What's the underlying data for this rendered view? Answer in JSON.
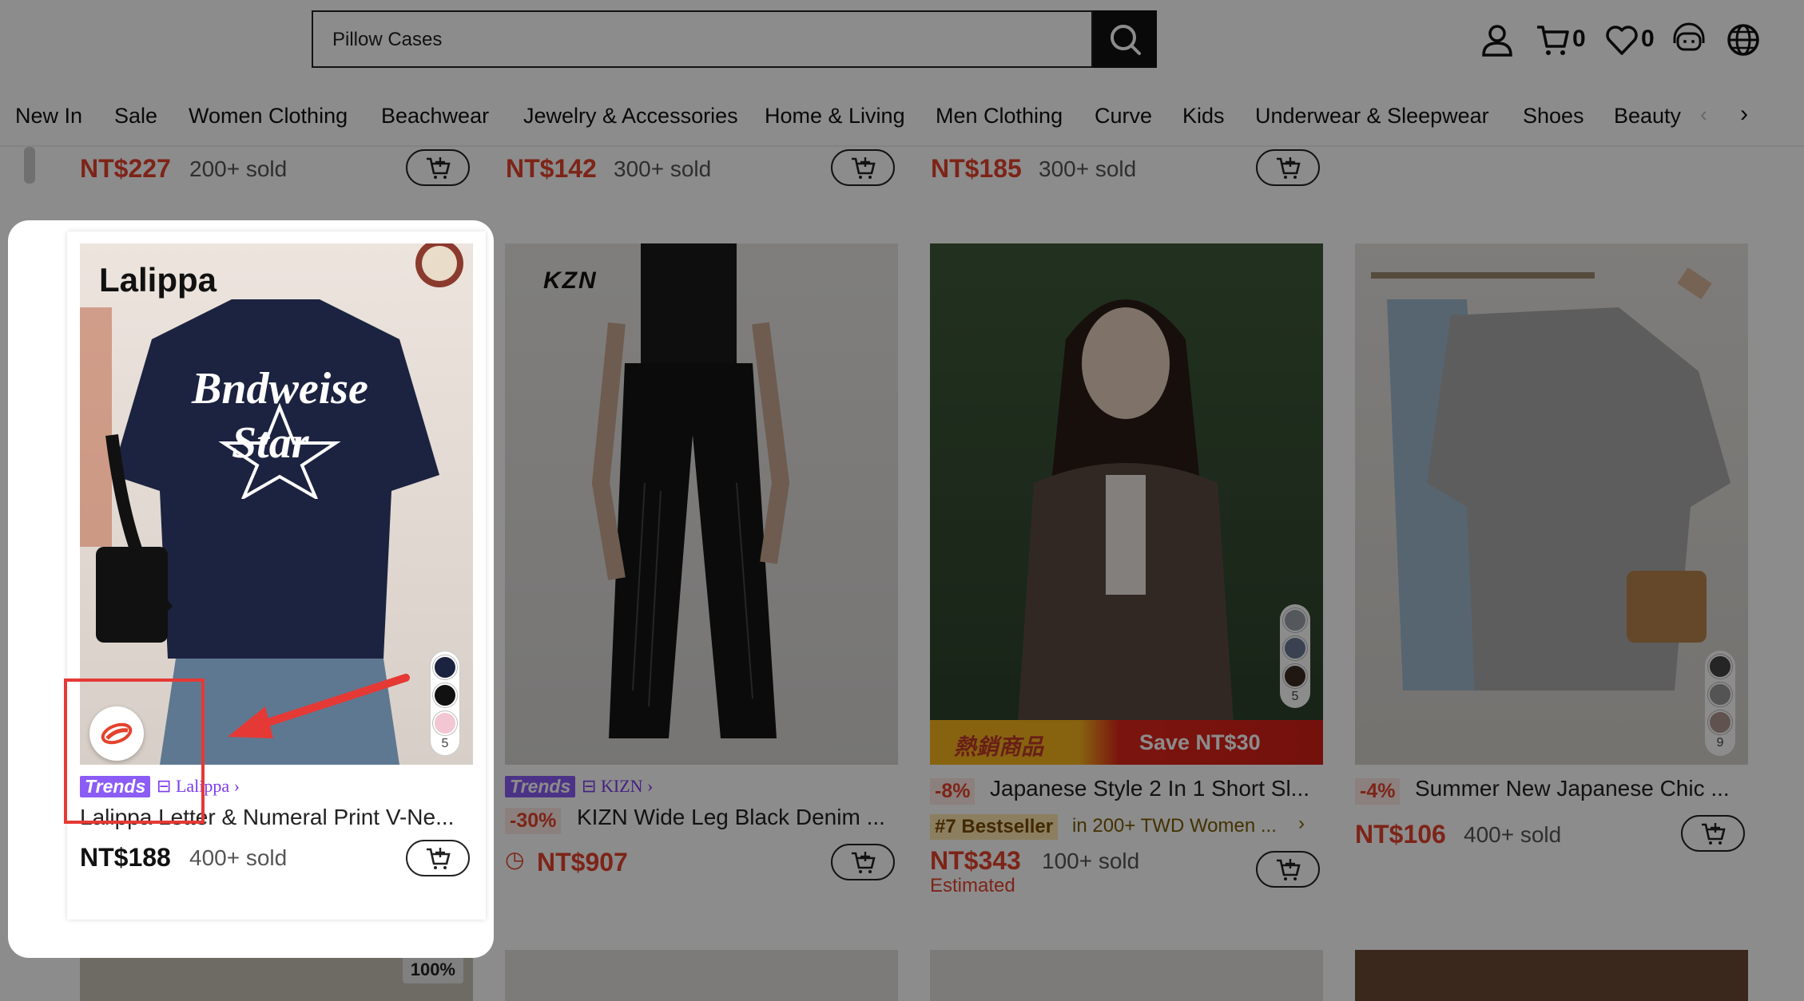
{
  "search": {
    "value": "Pillow Cases"
  },
  "header": {
    "cart_count": "0",
    "wishlist_count": "0"
  },
  "nav": {
    "items": [
      "New In",
      "Sale",
      "Women Clothing",
      "Beachwear",
      "Jewelry & Accessories",
      "Home & Living",
      "Men Clothing",
      "Curve",
      "Kids",
      "Underwear & Sleepwear",
      "Shoes",
      "Beauty"
    ]
  },
  "top_row": [
    {
      "price": "NT$227",
      "sold": "200+ sold"
    },
    {
      "price": "NT$142",
      "sold": "300+ sold"
    },
    {
      "price": "NT$185",
      "sold": "300+ sold"
    }
  ],
  "products": [
    {
      "brand_logo": "Lalippa",
      "shirt_text_1": "Bndweise",
      "shirt_text_2": "Star",
      "trends": "Trends",
      "brand": "Lalippa",
      "title": "Lalippa Letter & Numeral Print V-Ne...",
      "price": "NT$188",
      "sold": "400+ sold",
      "swatch_count": "5",
      "swatches": [
        "#1c2340",
        "#111111",
        "#f2c6d2"
      ]
    },
    {
      "brand_logo": "KZN",
      "trends": "Trends",
      "brand": "KIZN",
      "discount": "-30%",
      "title": "KIZN Wide Leg Black Denim ...",
      "price": "NT$907"
    },
    {
      "banner_left": "熱銷商品",
      "banner_right": "Save NT$30",
      "discount": "-8%",
      "title": "Japanese Style 2 In 1 Short Sl...",
      "bestseller": "#7 Bestseller",
      "bestseller_cat": "in 200+ TWD Women ...",
      "price": "NT$343",
      "sold": "100+ sold",
      "note": "Estimated",
      "swatch_count": "5"
    },
    {
      "discount": "-4%",
      "title": "Summer New Japanese Chic ...",
      "price": "NT$106",
      "sold": "400+ sold",
      "swatch_count": "9"
    }
  ],
  "bottom_row": {
    "badge": "100%"
  },
  "colors": {
    "accent_red": "#e4432d",
    "trends_purple": "#8b5cf6",
    "annotation_red": "#e53935"
  }
}
